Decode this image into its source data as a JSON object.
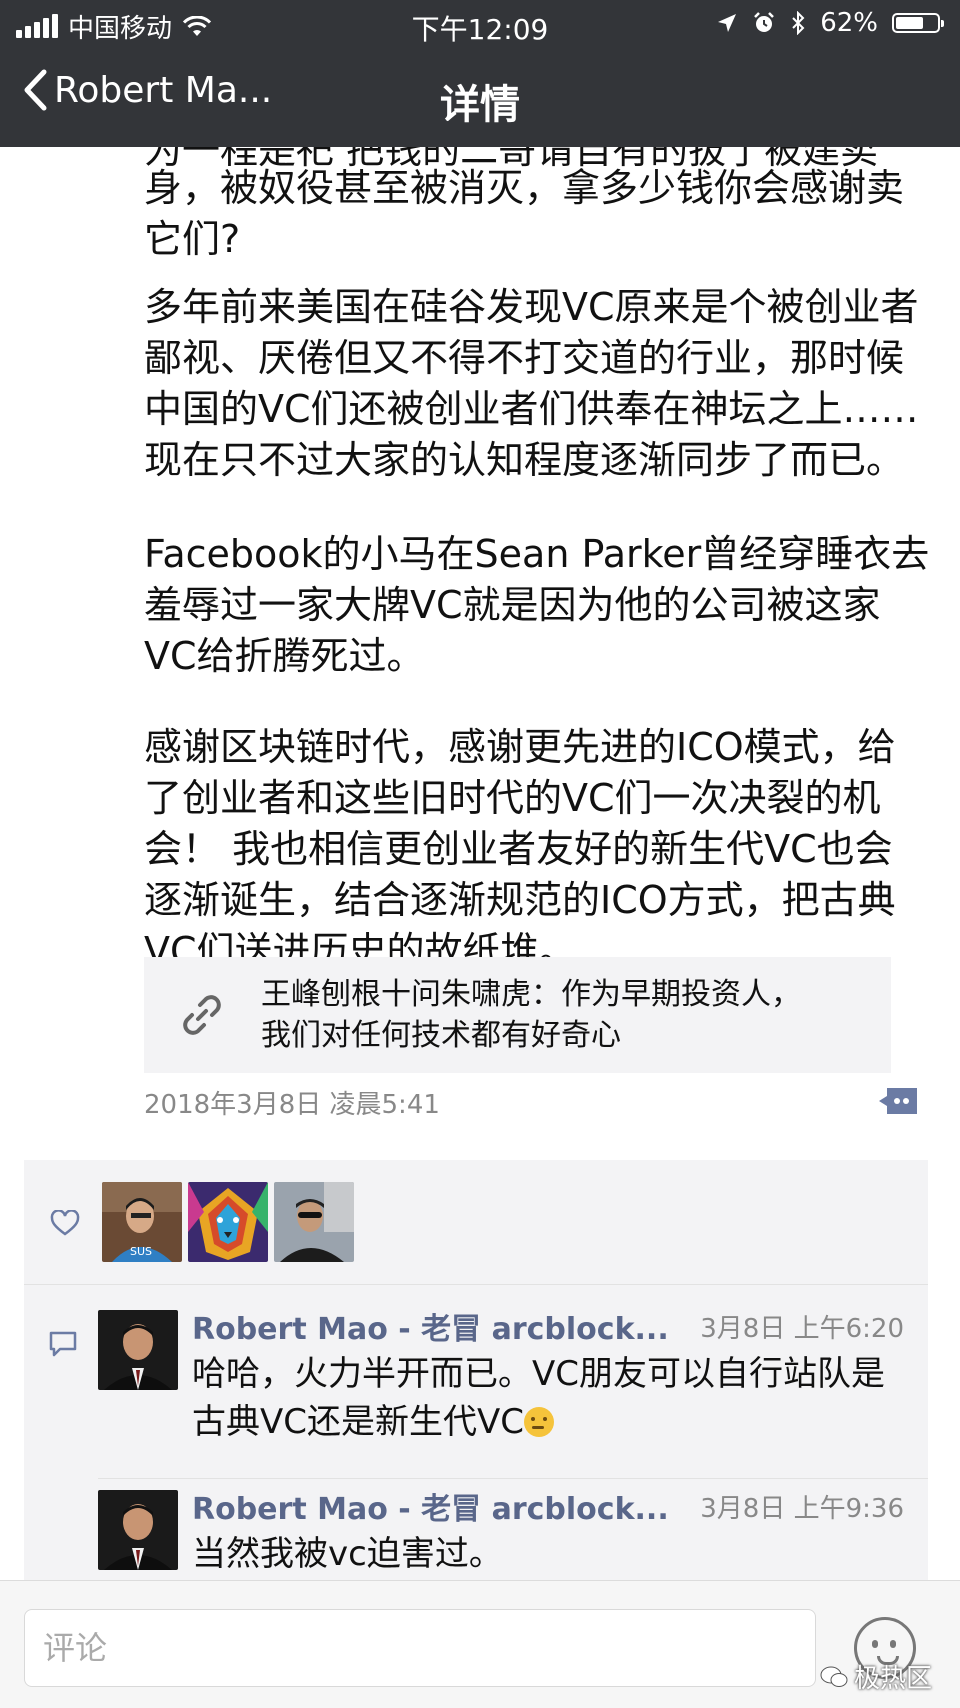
{
  "status_bar": {
    "carrier": "中国移动",
    "time": "下午12:09",
    "battery_percent": "62%",
    "battery_level": 0.62
  },
  "nav": {
    "back_label": "Robert Ma...",
    "title": "详情"
  },
  "article": {
    "cut_line": "为一程是祀 把钱的二哥请自有的拔了被建卖",
    "paragraphs": [
      "身，被奴役甚至被消灭，拿多少钱你会感谢卖\n它们?",
      "多年前来美国在硅谷发现VC原来是个被创业者\n鄙视、厌倦但又不得不打交道的行业，那时候\n中国的VC们还被创业者们供奉在神坛之上……\n现在只不过大家的认知程度逐渐同步了而已。",
      "Facebook的小马在Sean Parker曾经穿睡衣去\n羞辱过一家大牌VC就是因为他的公司被这家\nVC给折腾死过。",
      "感谢区块链时代，感谢更先进的ICO模式，给\n了创业者和这些旧时代的VC们一次决裂的机\n会！ 我也相信更创业者友好的新生代VC也会\n逐渐诞生，结合逐渐规范的ICO方式，把古典\nVC们送进历史的故纸堆。"
    ],
    "link_title": "王峰刨根十问朱啸虎：作为早期投资人，\n我们对任何技术都有好奇心",
    "timestamp": "2018年3月8日 凌晨5:41"
  },
  "comments": [
    {
      "name": "Robert Mao - 老冒 arcblock...",
      "time": "3月8日 上午6:20",
      "text": "哈哈，火力半开而已。VC朋友可以自行站队是古典VC还是新生代VC"
    },
    {
      "name": "Robert Mao - 老冒 arcblock...",
      "time": "3月8日 上午9:36",
      "text": "当然我被vc迫害过。"
    }
  ],
  "input": {
    "placeholder": "评论"
  },
  "watermark": "极热区",
  "colors": {
    "nav_bg": "#333539",
    "panel_bg": "#f3f3f5",
    "name_color": "#59668a",
    "timestamp_color": "#888888"
  },
  "icons": [
    "signal-icon",
    "wifi-icon",
    "location-icon",
    "alarm-icon",
    "bluetooth-icon",
    "battery-icon",
    "back-chevron-icon",
    "link-icon",
    "comment-bubble-icon",
    "heart-icon",
    "emoji-icon"
  ]
}
